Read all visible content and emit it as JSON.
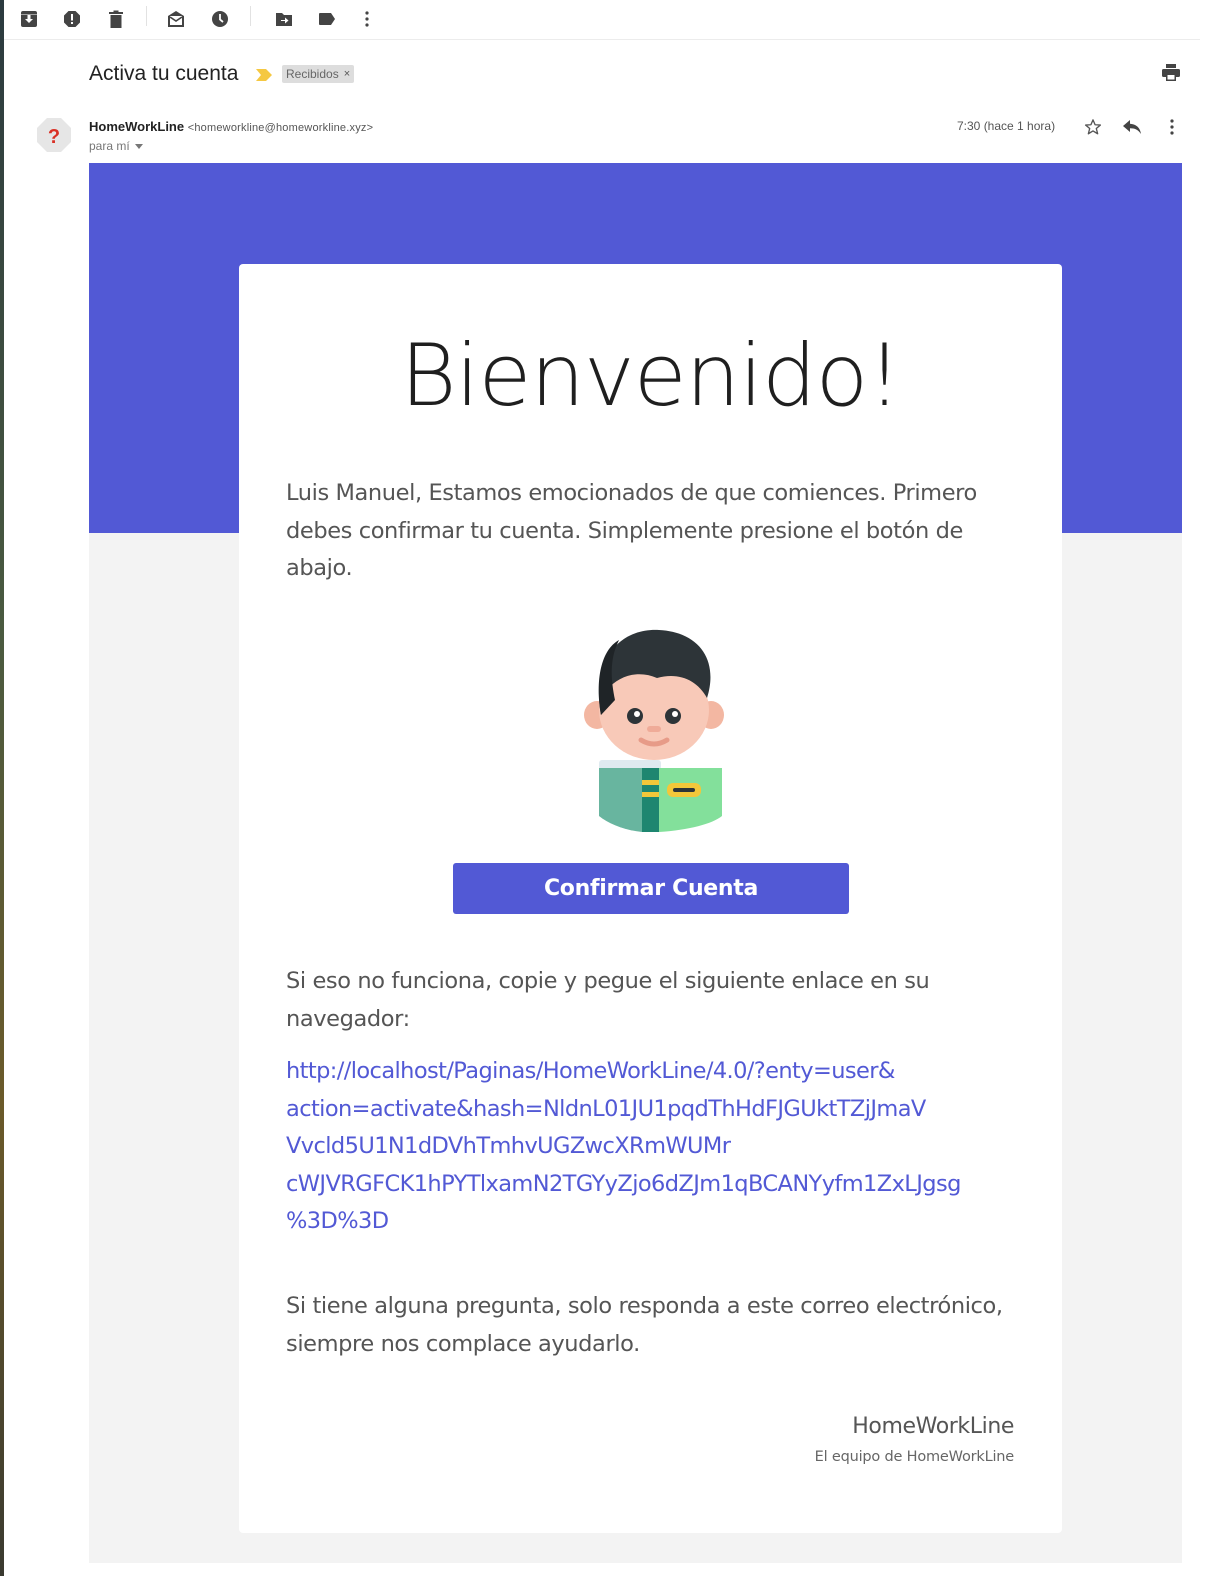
{
  "toolbar": {
    "buttons": [
      {
        "name": "archive",
        "icon": "archive-icon"
      },
      {
        "name": "report-spam",
        "icon": "report-spam-icon"
      },
      {
        "name": "delete",
        "icon": "trash-icon"
      },
      {
        "name": "mark-unread",
        "icon": "mark-unread-icon"
      },
      {
        "name": "snooze",
        "icon": "clock-icon"
      },
      {
        "name": "move-to",
        "icon": "move-to-folder-icon"
      },
      {
        "name": "labels",
        "icon": "label-icon"
      },
      {
        "name": "more",
        "icon": "more-vertical-icon"
      }
    ]
  },
  "message": {
    "subject": "Activa tu cuenta",
    "label": "Recibidos",
    "label_remove": "×",
    "sender_name": "HomeWorkLine",
    "sender_email": "<homeworkline@homeworkline.xyz>",
    "to": "para mí",
    "time": "7:30 (hace 1 hora)"
  },
  "email": {
    "heading": "Bienvenido!",
    "intro": "Luis Manuel, Estamos emocionados de que comiences. Primero debes confirmar tu cuenta. Simplemente presione el botón de abajo.",
    "button_label": "Confirmar Cuenta",
    "fallback_text": "Si eso no funciona, copie y pegue el siguiente enlace en su navegador:",
    "link_lines": [
      "http://localhost/Paginas/HomeWorkLine/4.0/?enty=user&",
      "action=activate&hash=NldnL01JU1pqdThHdFJGUktTZjJmaV",
      "Vvcld5U1N1dDVhTmhvUGZwcXRmWUMr",
      "cWJVRGFCK1hPYTlxamN2TGYyZjo6dZJm1qBCANYyfm1ZxLJgsg",
      "%3D%3D"
    ],
    "questions_text": "Si tiene alguna pregunta, solo responda a este correo electrónico, siempre nos complace ayudarlo.",
    "signature_name": "HomeWorkLine",
    "signature_team": "El equipo de HomeWorkLine"
  },
  "colors": {
    "brand": "#5259d5",
    "body_bg": "#f3f3f3",
    "card_bg": "#ffffff",
    "text": "#555555"
  }
}
